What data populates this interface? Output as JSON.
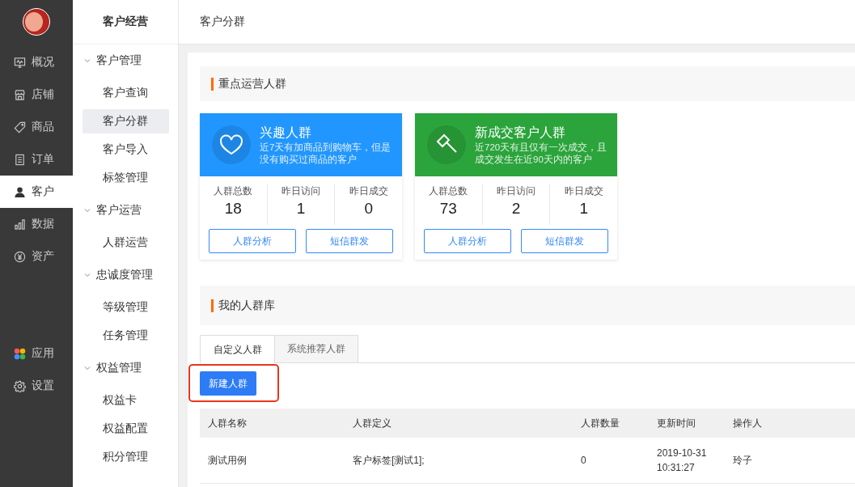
{
  "rail": {
    "items": [
      {
        "label": "概况",
        "selected": false
      },
      {
        "label": "店铺",
        "selected": false
      },
      {
        "label": "商品",
        "selected": false
      },
      {
        "label": "订单",
        "selected": false
      },
      {
        "label": "客户",
        "selected": true
      },
      {
        "label": "数据",
        "selected": false
      },
      {
        "label": "资产",
        "selected": false
      }
    ],
    "bottom_items": [
      {
        "label": "应用"
      },
      {
        "label": "设置"
      }
    ]
  },
  "sidebar": {
    "title": "客户经营",
    "groups": [
      {
        "label": "客户管理",
        "expanded": true,
        "children": [
          {
            "label": "客户查询",
            "selected": false
          },
          {
            "label": "客户分群",
            "selected": true
          },
          {
            "label": "客户导入",
            "selected": false
          },
          {
            "label": "标签管理",
            "selected": false
          }
        ]
      },
      {
        "label": "客户运营",
        "expanded": true,
        "children": [
          {
            "label": "人群运营",
            "selected": false
          }
        ]
      },
      {
        "label": "忠诚度管理",
        "expanded": true,
        "children": [
          {
            "label": "等级管理",
            "selected": false
          },
          {
            "label": "任务管理",
            "selected": false
          }
        ]
      },
      {
        "label": "权益管理",
        "expanded": true,
        "children": [
          {
            "label": "权益卡",
            "selected": false
          },
          {
            "label": "权益配置",
            "selected": false
          },
          {
            "label": "积分管理",
            "selected": false
          }
        ]
      }
    ]
  },
  "header": {
    "title": "客户分群"
  },
  "key_groups": {
    "title": "重点运营人群",
    "cards": [
      {
        "title": "兴趣人群",
        "description": "近7天有加商品到购物车，但是没有购买过商品的客户",
        "color": "#2196ff",
        "stats": [
          {
            "label": "人群总数",
            "value": "18"
          },
          {
            "label": "昨日访问",
            "value": "1"
          },
          {
            "label": "昨日成交",
            "value": "0"
          }
        ],
        "buttons": [
          "人群分析",
          "短信群发"
        ]
      },
      {
        "title": "新成交客户人群",
        "description": "近720天有且仅有一次成交，且成交发生在近90天内的客户",
        "color": "#2ba43c",
        "stats": [
          {
            "label": "人群总数",
            "value": "73"
          },
          {
            "label": "昨日访问",
            "value": "2"
          },
          {
            "label": "昨日成交",
            "value": "1"
          }
        ],
        "buttons": [
          "人群分析",
          "短信群发"
        ]
      }
    ]
  },
  "library": {
    "title": "我的人群库",
    "tabs": [
      {
        "label": "自定义人群",
        "selected": true
      },
      {
        "label": "系统推荐人群",
        "selected": false
      }
    ],
    "new_button": {
      "label": "新建人群",
      "highlighted": true
    },
    "table": {
      "columns": [
        "人群名称",
        "人群定义",
        "人群数量",
        "更新时间",
        "操作人"
      ],
      "rows": [
        [
          "测试用例",
          "客户标签[测试1];",
          "0",
          "2019-10-31 10:31:27",
          "玲子"
        ]
      ]
    }
  }
}
